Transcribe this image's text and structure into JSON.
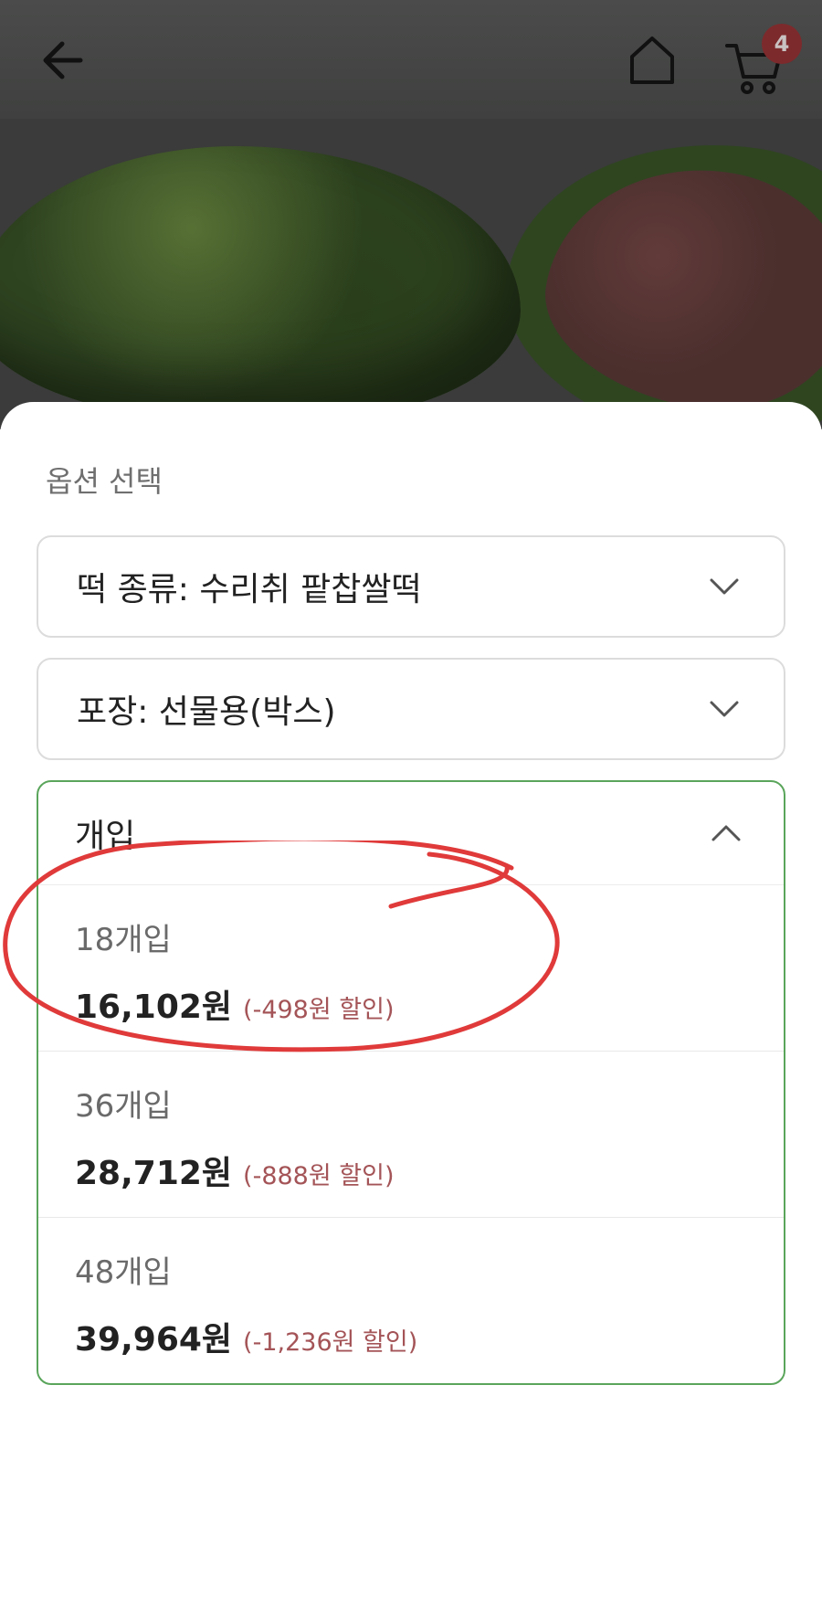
{
  "header": {
    "back_icon": "arrow-left-icon",
    "home_icon": "home-icon",
    "cart_icon": "cart-icon",
    "cart_count": "4"
  },
  "sheet": {
    "title": "옵션 선택",
    "selects": [
      {
        "label": "떡 종류: 수리취 팥찹쌀떡",
        "state": "collapsed"
      },
      {
        "label": "포장: 선물용(박스)",
        "state": "collapsed"
      }
    ],
    "open_select": {
      "label": "개입",
      "state": "expanded",
      "options": [
        {
          "qty": "18개입",
          "price": "16,102원",
          "discount": "(-498원 할인)"
        },
        {
          "qty": "36개입",
          "price": "28,712원",
          "discount": "(-888원 할인)"
        },
        {
          "qty": "48개입",
          "price": "39,964원",
          "discount": "(-1,236원 할인)"
        }
      ]
    }
  },
  "colors": {
    "open_border": "#5aa55b",
    "discount_text": "#a45457",
    "badge": "#7d2a2c",
    "annotation_circle": "#e03a3a"
  }
}
